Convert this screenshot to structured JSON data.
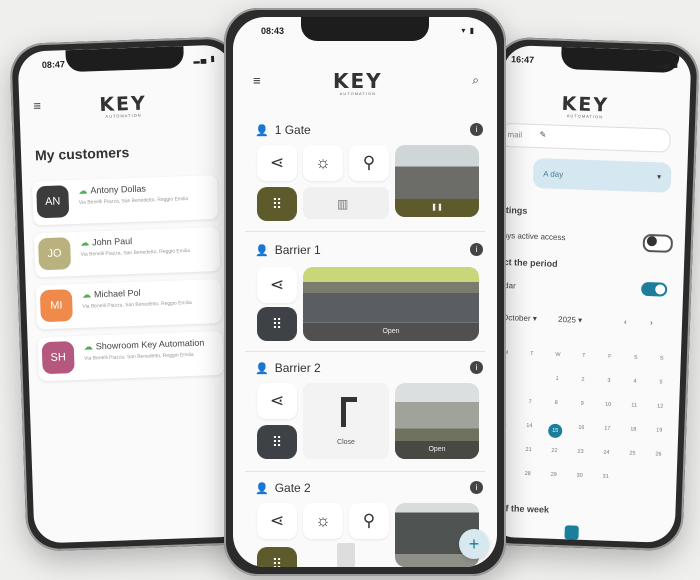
{
  "brand": {
    "logo": "KEY",
    "logo_sub": "AUTOMATION",
    "accent": "#1c7e9a",
    "kp_color": "#5d5a2c"
  },
  "left": {
    "time": "08:47",
    "title": "My customers",
    "customers": [
      {
        "initials": "AN",
        "name": "Antony Dollas",
        "address": "Via Benelli Piazza, San Benedetto, Reggio Emilia",
        "color": "#3c3c3c"
      },
      {
        "initials": "JO",
        "name": "John Paul",
        "address": "Via Benelli Piazza, San Benedetto, Reggio Emilia",
        "color": "#b9b27f"
      },
      {
        "initials": "MI",
        "name": "Michael Pol",
        "address": "Via Benelli Piazza, San Benedetto, Reggio Emilia",
        "color": "#f08a4b"
      },
      {
        "initials": "SH",
        "name": "Showroom Key Automation",
        "address": "Via Benelli Piazza, San Benedetto, Reggio Emilia",
        "color": "#b5577f"
      }
    ]
  },
  "center": {
    "time": "08:43",
    "devices": [
      {
        "name": "1 Gate"
      },
      {
        "name": "Barrier 1",
        "open_label": "Open"
      },
      {
        "name": "Barrier 2",
        "close_label": "Close",
        "open_label": "Open"
      },
      {
        "name": "Gate 2"
      }
    ]
  },
  "right": {
    "time": "16:47",
    "email_field": "mail",
    "select_value": "A day",
    "settings_label": "ettings",
    "always_active": "ways active access",
    "period_label": "lect the period",
    "calendar_label": "endar",
    "month": "October",
    "year": "2025",
    "week_header": [
      "M",
      "T",
      "W",
      "T",
      "F",
      "S",
      "S"
    ],
    "selected_day": "15",
    "days_label": "ys of the week"
  }
}
